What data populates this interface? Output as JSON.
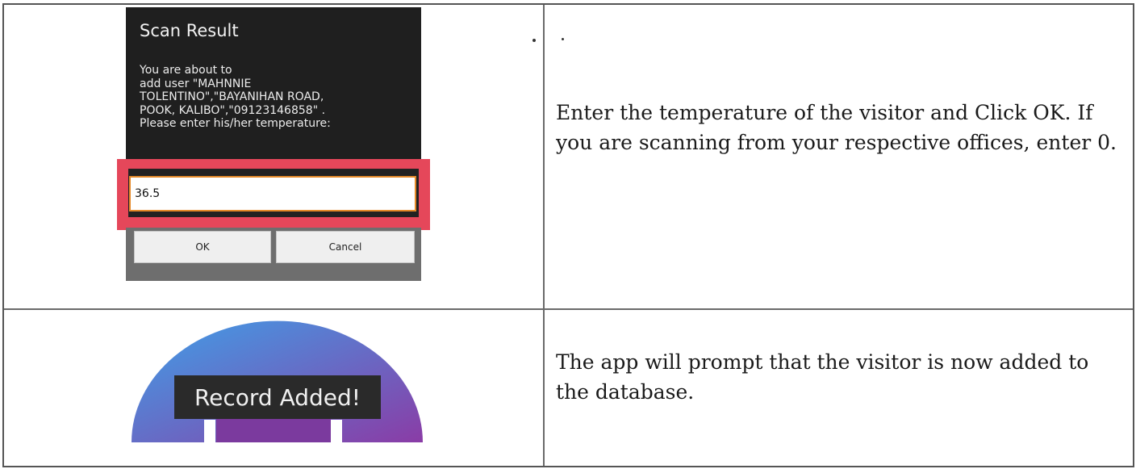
{
  "scan_result_dialog": {
    "title": "Scan Result",
    "message": "You are about to\nadd user \"MAHNNIE\nTOLENTINO\",\"BAYANIHAN ROAD,\nPOOK, KALIBO\",\"09123146858\" .\nPlease enter his/her temperature:",
    "temperature_value": "36.5",
    "ok_label": "OK",
    "cancel_label": "Cancel"
  },
  "toast": {
    "text": "Record Added!",
    "colors": {
      "gradient_start": "#3fa0e8",
      "gradient_end": "#8a3ca6"
    }
  },
  "steps": [
    {
      "text": "Enter the temperature of the visitor and Click OK. If you are scanning from your respective offices, enter 0."
    },
    {
      "text": "The app will prompt that the visitor is now added to the database."
    }
  ],
  "colors": {
    "highlight": "#e5475a",
    "input_border": "#e58a29",
    "dialog_bg": "#1f1f1f"
  }
}
